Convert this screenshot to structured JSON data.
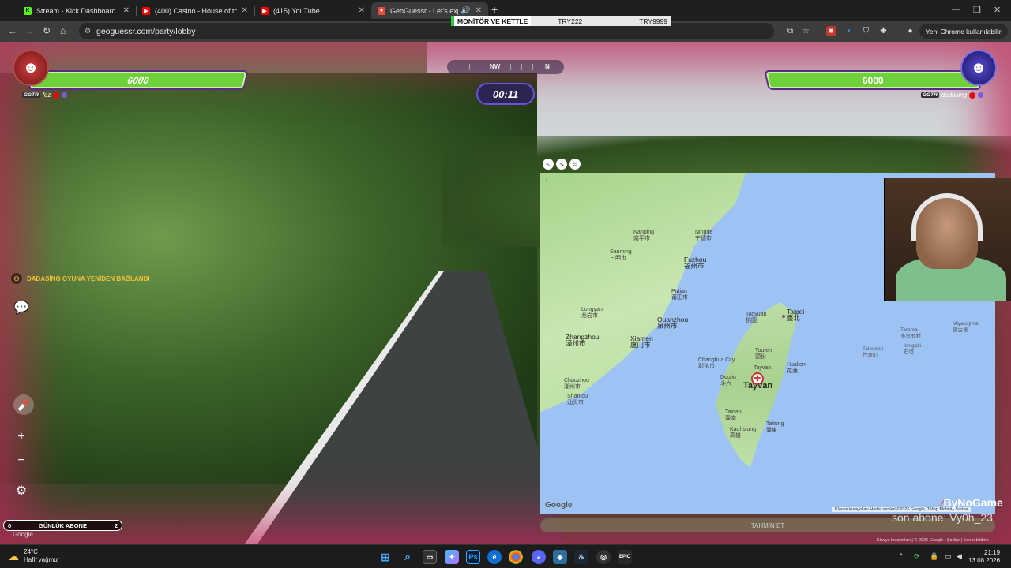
{
  "browser": {
    "tabs": [
      {
        "title": "Stream - Kick Dashboard",
        "color": "#53fc18",
        "glyph": "K"
      },
      {
        "title": "(400) Casino - House of the Ris",
        "color": "#ff0000",
        "glyph": "▶"
      },
      {
        "title": "(415) YouTube",
        "color": "#ff0000",
        "glyph": "▶"
      },
      {
        "title": "GeoGuessr - Let's explore th",
        "color": "#e74c3c",
        "glyph": "●"
      }
    ],
    "overlay": {
      "product": "MONİTÖR VE KETTLE",
      "price_a": "TRY222",
      "price_b": "TRY9999"
    },
    "url": "geoguessr.com/party/lobby",
    "profile_label": "Yeni Chrome kullanılabilir"
  },
  "game": {
    "left_player": {
      "score": "6000",
      "clan": "GGTR",
      "name": "fez"
    },
    "right_player": {
      "score": "6000",
      "clan": "GGTR",
      "name": "dadasing"
    },
    "compass": {
      "nw": "NW",
      "n": "N"
    },
    "timer": "00:11",
    "reconnect_msg": "DADASİNG OYUNA YENİDEN BAĞLANDI",
    "abone": {
      "left": "0",
      "label": "GÜNLÜK ABONE",
      "right": "2",
      "progress": 0
    },
    "google_watermark": "Google"
  },
  "map": {
    "labels": {
      "nanping": "Nanping",
      "nanping_zh": "南平市",
      "ningde": "Ningde",
      "ningde_zh": "宁德市",
      "sanming": "Sanming",
      "sanming_zh": "三明市",
      "fuzhou": "Fuzhou",
      "fuzhou_zh": "福州市",
      "putian": "Putian",
      "putian_zh": "莆田市",
      "longyan": "Longyan",
      "longyan_zh": "龙岩市",
      "quanzhou": "Quanzhou",
      "quanzhou_zh": "泉州市",
      "zhangzhou": "Zhangzhou",
      "zhangzhou_zh": "漳州市",
      "xiamen": "Xiamen",
      "xiamen_zh": "厦门市",
      "chaozhou": "Chaozhou",
      "chaozhou_zh": "潮州市",
      "shantou": "Shantou",
      "shantou_zh": "汕头市",
      "taoyuan": "Taoyuan",
      "taoyuan_zh": "桃園",
      "taipei": "Taipei",
      "taipei_zh": "臺北",
      "toufen": "Toufen",
      "toufen_zh": "頭份",
      "changhua": "Changhua City",
      "changhua_zh": "彰化市",
      "hualien": "Hualien",
      "hualien_zh": "花蓮",
      "douliu": "Douliu",
      "douliu_zh": "斗六",
      "tayvan_small": "Tayvan",
      "tayvan": "Tayvan",
      "tainan": "Tainan",
      "tainan_zh": "臺南",
      "taitung": "Taitung",
      "taitung_zh": "臺東",
      "kaohsiung": "Kaohsiung",
      "kaohsiung_zh": "高雄",
      "tarama": "Tarama",
      "tarama_zh": "多良間村",
      "ishigaki": "Ishigaki",
      "ishigaki_zh": "石垣",
      "taketomi": "Taketomi",
      "taketomi_zh": "竹富町",
      "miyakojima": "Miyakojima",
      "miyakojima_zh": "宮古島"
    },
    "google": "Google",
    "attribution": "Klavye kısayolları   Harita verileri ©2026 Google, TMap Mobility   Şartlar",
    "guess_btn": "TAHMİN ET",
    "attr2": "Klavye kısayolları  |  © 2026 Google  |  Şartlar  |  Sorun bildirin"
  },
  "stream": {
    "brand": "ByNoGame",
    "sub_alert": "son abone: Vy0h_23"
  },
  "taskbar": {
    "temp": "24°C",
    "weather": "Hafif yağmur",
    "time": "21:19",
    "date": "13.08.2026"
  }
}
